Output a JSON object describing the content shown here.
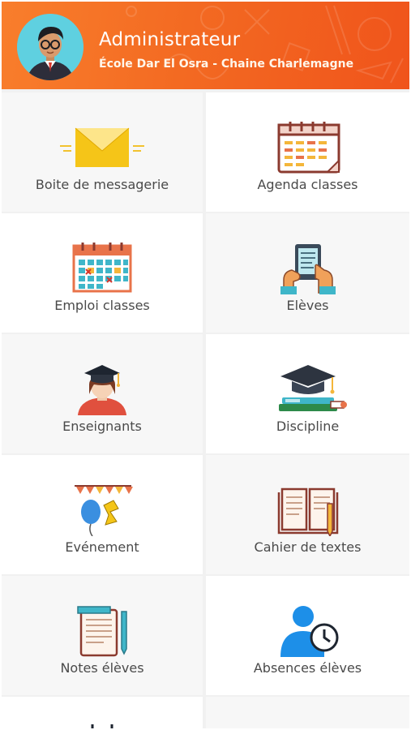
{
  "header": {
    "title": "Administrateur",
    "subtitle": "École Dar El Osra - Chaine Charlemagne"
  },
  "tiles": [
    {
      "label": "Boite de messagerie",
      "icon": "envelope-icon"
    },
    {
      "label": "Agenda classes",
      "icon": "calendar-agenda-icon"
    },
    {
      "label": "Emploi classes",
      "icon": "timetable-calendar-icon"
    },
    {
      "label": "Elèves",
      "icon": "tablet-hands-icon"
    },
    {
      "label": "Enseignants",
      "icon": "graduate-teacher-icon"
    },
    {
      "label": "Discipline",
      "icon": "mortarboard-books-icon"
    },
    {
      "label": "Evénement",
      "icon": "balloon-bunting-icon"
    },
    {
      "label": "Cahier de textes",
      "icon": "open-book-pencil-icon"
    },
    {
      "label": "Notes élèves",
      "icon": "notes-pencil-icon"
    },
    {
      "label": "Absences élèves",
      "icon": "user-clock-icon"
    }
  ],
  "colors": {
    "header_start": "#f97e2c",
    "header_end": "#f0541b",
    "label_text": "#4a4a4a"
  }
}
